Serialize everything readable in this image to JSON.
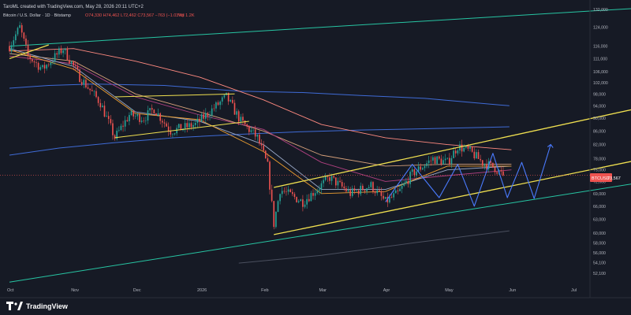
{
  "header": {
    "creator": "TaroML created with TradingView.com, May 28, 2026 20:11 UTC+2",
    "symbol_line": "Bitcoin / U.S. Dollar · 1D · Bitstamp",
    "ohlc": "O74,330 H74,462 L72,462 C73,567 −763 (−1.03%)",
    "volume": "Vol 1.2K"
  },
  "price_tag": {
    "symbol": "BTCUSD",
    "price": "73,567"
  },
  "brand": {
    "logo_text": "TradingView"
  },
  "colors": {
    "background": "#161a25",
    "up_candle": "#26a69a",
    "down_candle": "#ef5350",
    "channel": "#f0e050",
    "trend_teal": "#27c5a3",
    "blue_line": "#3f6bd6",
    "pattern": "#4a7bff"
  },
  "chart_data": {
    "type": "candlestick",
    "y_scale": "log",
    "ylim": [
      45000,
      133000
    ],
    "y_ticks": [
      "132,000",
      "124,000",
      "116,000",
      "111,000",
      "106,000",
      "102,000",
      "98,000",
      "94,000",
      "90,000",
      "86,000",
      "82,000",
      "78,000",
      "75,000",
      "72,000",
      "69,000",
      "66,000",
      "63,000",
      "60,000",
      "58,000",
      "56,000",
      "54,100",
      "52,100"
    ],
    "y_tick_values": [
      132000,
      124000,
      116000,
      111000,
      106000,
      102000,
      98000,
      94000,
      90000,
      86000,
      82000,
      78000,
      75000,
      72000,
      69000,
      66000,
      63000,
      60000,
      58000,
      56000,
      54100,
      52100
    ],
    "x_ticks": [
      "Oct",
      "Nov",
      "Dec",
      "2026",
      "Feb",
      "Mar",
      "Apr",
      "May",
      "Jun",
      "Jul"
    ],
    "x_tick_dates": [
      "2025-10-01",
      "2025-11-01",
      "2025-12-01",
      "2026-01-01",
      "2026-02-01",
      "2026-03-01",
      "2026-04-01",
      "2026-05-01",
      "2026-06-01",
      "2026-07-01"
    ],
    "last_date": "2026-05-28",
    "path_keypoints": [
      [
        "2025-10-01",
        116000
      ],
      [
        "2025-10-06",
        124000
      ],
      [
        "2025-10-10",
        112000
      ],
      [
        "2025-10-17",
        107000
      ],
      [
        "2025-10-27",
        115000
      ],
      [
        "2025-11-04",
        104000
      ],
      [
        "2025-11-14",
        95000
      ],
      [
        "2025-11-21",
        84000
      ],
      [
        "2025-11-28",
        91000
      ],
      [
        "2025-12-05",
        90000
      ],
      [
        "2025-12-10",
        93000
      ],
      [
        "2025-12-18",
        86000
      ],
      [
        "2025-12-30",
        88000
      ],
      [
        "2026-01-14",
        97000
      ],
      [
        "2026-01-21",
        89000
      ],
      [
        "2026-01-29",
        84000
      ],
      [
        "2026-02-03",
        76000
      ],
      [
        "2026-02-06",
        62000
      ],
      [
        "2026-02-09",
        70000
      ],
      [
        "2026-02-20",
        67000
      ],
      [
        "2026-03-05",
        73000
      ],
      [
        "2026-03-15",
        69000
      ],
      [
        "2026-03-25",
        71000
      ],
      [
        "2026-04-01",
        67000
      ],
      [
        "2026-04-07",
        69000
      ],
      [
        "2026-04-14",
        74000
      ],
      [
        "2026-04-24",
        78000
      ],
      [
        "2026-05-01",
        77000
      ],
      [
        "2026-05-06",
        81500
      ],
      [
        "2026-05-12",
        80000
      ],
      [
        "2026-05-18",
        77000
      ],
      [
        "2026-05-24",
        75500
      ],
      [
        "2026-05-28",
        73567
      ]
    ],
    "channel_upper": [
      [
        "2026-02-06",
        70500
      ],
      [
        "2026-07-31",
        93000
      ]
    ],
    "channel_lower": [
      [
        "2026-02-06",
        59700
      ],
      [
        "2026-07-31",
        77500
      ]
    ],
    "top_channel": [
      [
        "2025-10-01",
        111000
      ],
      [
        "2025-10-20",
        116500
      ]
    ],
    "dec_channel_upper": [
      [
        "2025-11-21",
        97000
      ],
      [
        "2026-01-18",
        98000
      ]
    ],
    "dec_channel_lower": [
      [
        "2025-11-21",
        84000
      ],
      [
        "2026-01-25",
        89000
      ]
    ],
    "teal_upper": [
      [
        "2025-10-01",
        116000
      ],
      [
        "2026-07-31",
        132500
      ]
    ],
    "teal_lower": [
      [
        "2025-10-01",
        50500
      ],
      [
        "2026-07-31",
        71500
      ]
    ],
    "zigzag": [
      [
        "2026-04-01",
        67000
      ],
      [
        "2026-04-14",
        76500
      ],
      [
        "2026-04-27",
        68000
      ],
      [
        "2026-05-06",
        76500
      ],
      [
        "2026-05-14",
        66000
      ],
      [
        "2026-05-23",
        79500
      ],
      [
        "2026-05-30",
        68000
      ],
      [
        "2026-06-06",
        77000
      ],
      [
        "2026-06-12",
        67800
      ],
      [
        "2026-06-20",
        82000
      ]
    ],
    "moving_averages": [
      {
        "color": "#ff8a80",
        "points": [
          [
            "2025-10-01",
            114000
          ],
          [
            "2025-11-01",
            115000
          ],
          [
            "2025-12-01",
            110000
          ],
          [
            "2026-01-01",
            104000
          ],
          [
            "2026-02-01",
            96000
          ],
          [
            "2026-03-01",
            88000
          ],
          [
            "2026-04-01",
            84000
          ],
          [
            "2026-05-01",
            82000
          ],
          [
            "2026-06-01",
            80500
          ]
        ]
      },
      {
        "color": "#d6a07a",
        "points": [
          [
            "2025-10-01",
            113000
          ],
          [
            "2025-11-01",
            110000
          ],
          [
            "2025-12-01",
            98000
          ],
          [
            "2026-01-01",
            92000
          ],
          [
            "2026-02-01",
            86000
          ],
          [
            "2026-03-01",
            79000
          ],
          [
            "2026-04-01",
            76000
          ],
          [
            "2026-05-01",
            76500
          ],
          [
            "2026-06-01",
            76500
          ]
        ]
      },
      {
        "color": "#b04080",
        "points": [
          [
            "2025-10-01",
            112000
          ],
          [
            "2025-11-01",
            109000
          ],
          [
            "2025-12-01",
            97000
          ],
          [
            "2026-01-01",
            91000
          ],
          [
            "2026-02-01",
            86500
          ],
          [
            "2026-03-01",
            77000
          ],
          [
            "2026-04-01",
            72000
          ],
          [
            "2026-05-01",
            73500
          ],
          [
            "2026-06-01",
            75000
          ]
        ]
      },
      {
        "color": "#9aa9c8",
        "points": [
          [
            "2025-10-01",
            115000
          ],
          [
            "2025-11-01",
            108000
          ],
          [
            "2025-12-01",
            92000
          ],
          [
            "2026-01-01",
            89000
          ],
          [
            "2026-02-01",
            82000
          ],
          [
            "2026-03-01",
            70000
          ],
          [
            "2026-04-01",
            70000
          ],
          [
            "2026-05-01",
            75000
          ],
          [
            "2026-06-01",
            76000
          ]
        ]
      },
      {
        "color": "#f0a030",
        "points": [
          [
            "2025-10-01",
            114500
          ],
          [
            "2025-11-01",
            107000
          ],
          [
            "2025-12-01",
            91500
          ],
          [
            "2026-01-01",
            89500
          ],
          [
            "2026-02-01",
            80000
          ],
          [
            "2026-03-01",
            69000
          ],
          [
            "2026-04-01",
            69500
          ],
          [
            "2026-05-01",
            76000
          ],
          [
            "2026-06-01",
            76000
          ]
        ]
      }
    ],
    "blue_step_line": [
      [
        "2025-10-01",
        100000
      ],
      [
        "2025-10-20",
        101000
      ],
      [
        "2025-11-10",
        101500
      ],
      [
        "2025-12-15",
        101000
      ],
      [
        "2026-01-20",
        99000
      ],
      [
        "2026-02-20",
        98500
      ],
      [
        "2026-03-20",
        97500
      ],
      [
        "2026-04-20",
        96500
      ],
      [
        "2026-05-31",
        94000
      ]
    ],
    "blue_lower_line": [
      [
        "2025-10-01",
        79000
      ],
      [
        "2025-10-25",
        81000
      ],
      [
        "2025-11-20",
        82500
      ],
      [
        "2025-12-20",
        84000
      ],
      [
        "2026-01-20",
        85000
      ],
      [
        "2026-02-20",
        85800
      ],
      [
        "2026-03-20",
        86300
      ],
      [
        "2026-04-20",
        86700
      ],
      [
        "2026-05-31",
        87300
      ]
    ],
    "grey_line": [
      [
        "2026-01-20",
        54000
      ],
      [
        "2026-03-01",
        55500
      ],
      [
        "2026-04-15",
        58000
      ],
      [
        "2026-05-31",
        60500
      ]
    ]
  }
}
